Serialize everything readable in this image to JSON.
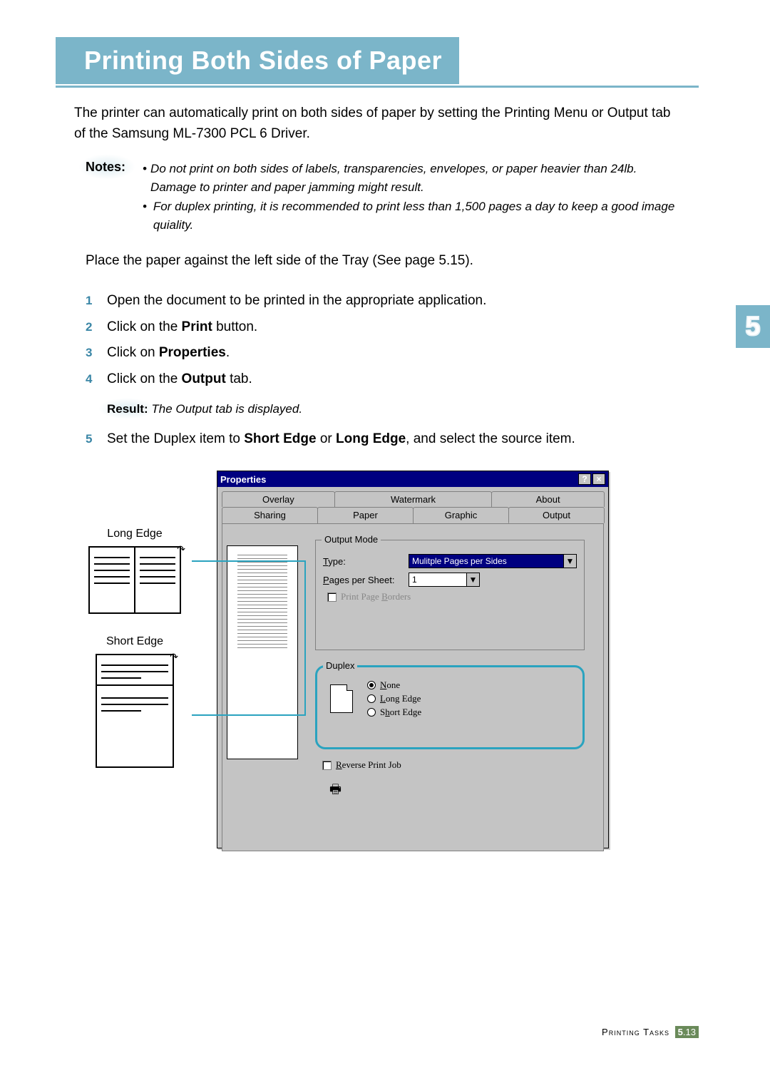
{
  "header": {
    "title": "Printing Both Sides of Paper"
  },
  "intro": "The printer can automatically print on both sides of paper by setting the Printing Menu or Output tab of the Samsung ML-7300 PCL 6 Driver.",
  "notes": {
    "label": "Notes:",
    "items": [
      "Do not print on both sides of labels, transparencies, envelopes, or paper heavier than 24lb. Damage to printer and paper jamming might result.",
      "For duplex printing, it is recommended to print less than 1,500 pages a day to keep a good image quiality."
    ]
  },
  "place_paper": "Place the paper against the left side of the Tray (See page 5.15).",
  "steps": {
    "s1": "Open the document to be printed in the appropriate application.",
    "s2_pre": "Click on the ",
    "s2_bold": "Print",
    "s2_post": " button.",
    "s3_pre": "Click on ",
    "s3_bold": "Properties",
    "s3_post": ".",
    "s4_pre": "Click on the ",
    "s4_bold": "Output",
    "s4_post": " tab.",
    "s5_pre": "Set the Duplex item to ",
    "s5_b1": "Short Edge",
    "s5_mid": " or ",
    "s5_b2": "Long Edge",
    "s5_post": ", and select the source item."
  },
  "result": {
    "label": "Result:",
    "text": "The Output tab is displayed."
  },
  "chapter": "5",
  "callouts": {
    "long_edge": "Long Edge",
    "short_edge": "Short Edge"
  },
  "dialog": {
    "title": "Properties",
    "help_btn": "?",
    "close_btn": "×",
    "tabs_back": [
      "Overlay",
      "Watermark",
      "About"
    ],
    "tabs_front": [
      "Sharing",
      "Paper",
      "Graphic",
      "Output"
    ],
    "output_mode": {
      "legend": "Output Mode",
      "type_label": "Type:",
      "type_value": "Mulitple Pages per Sides",
      "pages_label": "Pages per Sheet:",
      "pages_value": "1",
      "borders_label": "Print Page Borders"
    },
    "duplex": {
      "legend": "Duplex",
      "none": "None",
      "long": "Long Edge",
      "short": "Short Edge"
    },
    "reverse": "Reverse Print Job"
  },
  "footer": {
    "section": "Printing Tasks",
    "chapter": "5",
    "page": "13"
  }
}
